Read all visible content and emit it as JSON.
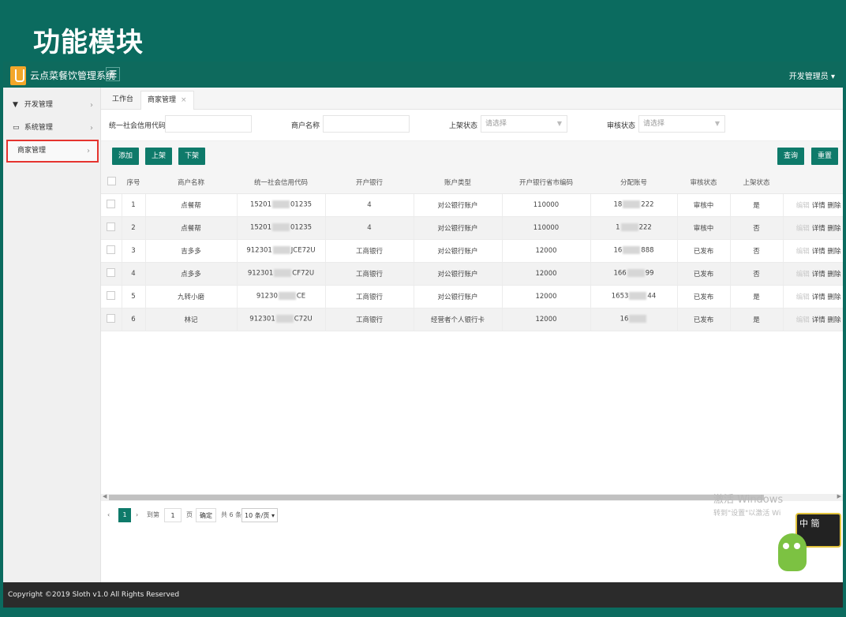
{
  "slide": {
    "title": "功能模块"
  },
  "header": {
    "app_name": "云点菜餐饮管理系统",
    "menu_icon": "☰",
    "user": "开发管理员 ▾"
  },
  "sidebar": {
    "items": [
      {
        "label": "开发管理",
        "icon": "filter-icon"
      },
      {
        "label": "系统管理",
        "icon": "monitor-icon"
      },
      {
        "label": "商家管理",
        "icon": ""
      }
    ]
  },
  "tabs": [
    {
      "label": "工作台"
    },
    {
      "label": "商家管理",
      "close": "×"
    }
  ],
  "filter": {
    "credit_code_label": "统一社会信用代码",
    "name_label": "商户名称",
    "shelf_status_label": "上架状态",
    "shelf_status_value": "请选择",
    "audit_status_label": "审核状态",
    "audit_status_value": "请选择"
  },
  "toolbar": {
    "add": "添加",
    "up": "上架",
    "down": "下架",
    "query": "查询",
    "reset": "重置"
  },
  "table": {
    "headers": [
      "序号",
      "商户名称",
      "统一社会信用代码",
      "开户银行",
      "账户类型",
      "开户银行省市编码",
      "分配账号",
      "审核状态",
      "上架状态"
    ],
    "rows": [
      {
        "no": "1",
        "name": "点餐帮",
        "code_a": "15201",
        "code_b": "01235",
        "bank": "4",
        "type": "对公银行账户",
        "area": "110000",
        "acct_a": "18",
        "acct_b": "222",
        "audit": "审核中",
        "shelf": "是"
      },
      {
        "no": "2",
        "name": "点餐帮",
        "code_a": "15201",
        "code_b": "01235",
        "bank": "4",
        "type": "对公银行账户",
        "area": "110000",
        "acct_a": "1",
        "acct_b": "222",
        "audit": "审核中",
        "shelf": "否"
      },
      {
        "no": "3",
        "name": "吉多多",
        "code_a": "912301",
        "code_b": "JCE72U",
        "bank": "工商银行",
        "type": "对公银行账户",
        "area": "12000",
        "acct_a": "16",
        "acct_b": "888",
        "audit": "已发布",
        "shelf": "否"
      },
      {
        "no": "4",
        "name": "点多多",
        "code_a": "912301",
        "code_b": "CF72U",
        "bank": "工商银行",
        "type": "对公银行账户",
        "area": "12000",
        "acct_a": "166",
        "acct_b": "99",
        "audit": "已发布",
        "shelf": "否"
      },
      {
        "no": "5",
        "name": "九转小磨",
        "code_a": "91230",
        "code_b": "CE",
        "bank": "工商银行",
        "type": "对公银行账户",
        "area": "12000",
        "acct_a": "1653",
        "acct_b": "44",
        "audit": "已发布",
        "shelf": "是"
      },
      {
        "no": "6",
        "name": "林记",
        "code_a": "912301",
        "code_b": "C72U",
        "bank": "工商银行",
        "type": "经营者个人银行卡",
        "area": "12000",
        "acct_a": "16",
        "acct_b": "",
        "audit": "已发布",
        "shelf": "是"
      }
    ],
    "ops": {
      "faint": "编辑",
      "detail": "详情",
      "delete": "删除"
    }
  },
  "pager": {
    "current": "1",
    "goto": "到第",
    "page_value": "1",
    "page_unit": "页",
    "confirm": "确定",
    "total": "共 6 条",
    "per_page": "10 条/页 ▾"
  },
  "footer": {
    "copyright": "Copyright ©2019 Sloth v1.0 All Rights Reserved"
  },
  "watermark": {
    "line1": "激活 Windows",
    "line2": "转到\"设置\"以激活 Wi"
  },
  "badge": {
    "text": "中 簡"
  }
}
